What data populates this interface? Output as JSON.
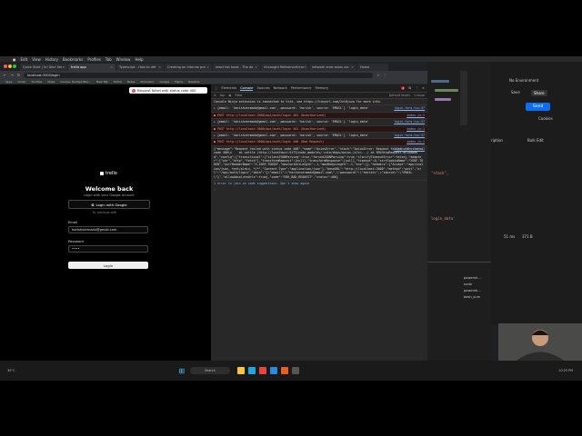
{
  "menubar": {
    "items": [
      "Edit",
      "View",
      "History",
      "Bookmarks",
      "Profiles",
      "Tab",
      "Window",
      "Help"
    ]
  },
  "browser": {
    "tabs": [
      {
        "label": "Quick Start | Sri Devi Ver"
      },
      {
        "label": "trello app",
        "active": true
      },
      {
        "label": "Typescript - How to def"
      },
      {
        "label": "Creating an internal pro"
      },
      {
        "label": "react hot toast - The do"
      },
      {
        "label": "Uncaught ReferenceError"
      },
      {
        "label": "network error axios via"
      },
      {
        "label": "Home"
      }
    ],
    "url": "localhost:3000/login",
    "bookmarks": [
      "Apps",
      "Gmail",
      "YouTube",
      "Maps",
      "Course: DevOps Boo...",
      "New Tab",
      "TikTok",
      "Notes",
      "Pomodoro",
      "Google",
      "Figma",
      "Readme"
    ]
  },
  "page": {
    "toast": "Request failed with status code 400",
    "logo": "trello",
    "title": "Welcome back",
    "subtitle": "Login with your Google account",
    "google_button": "Login with Google",
    "divider": "Or continue with",
    "email_label": "Email",
    "email_value": "harishvermadx@gmail.com",
    "password_label": "Password",
    "password_value": "••••",
    "login_button": "Login"
  },
  "devtools": {
    "tabs": [
      "Elements",
      "Console",
      "Sources",
      "Network",
      "Performance",
      "Memory"
    ],
    "active_tab": "Console",
    "error_count": "4",
    "filter_context": "top",
    "filter_placeholder": "Filter",
    "levels": "Default levels",
    "issues": "1 Issue",
    "messages": [
      {
        "type": "info",
        "text": "Console Ninja extension is connected to Vite, see https://tinyurl.com/2vt8jxzw for more info.",
        "src": "index.js:1"
      },
      {
        "type": "log",
        "text": "▸ {email: 'harishvermadx@gmail.com', password: 'harish', source: 'EMAIL'} 'login_data'",
        "src": "login-form.tsx:37"
      },
      {
        "type": "err",
        "text": "● POST http://localhost:3000/api/auth/login 401 (Unauthorized)",
        "src": "index.js:1"
      },
      {
        "type": "log",
        "text": "▸ {email: 'harishvermadx@gmail.com', password: 'harish', source: 'EMAIL'} 'login_data'",
        "src": "login-form.tsx:37"
      },
      {
        "type": "err",
        "text": "● POST http://localhost:3000/api/auth/login 401 (Unauthorized)",
        "src": "index.js:1"
      },
      {
        "type": "log",
        "text": "▸ {email: 'harishvermadx@gmail.com', password: 'harish', source: 'EMAIL'} 'login_data'",
        "src": "login-form.tsx:37"
      },
      {
        "type": "err",
        "text": "● POST http://localhost:3000/api/auth/login 400 (Bad Request)",
        "src": "index.js:1"
      },
      {
        "type": "log",
        "text": "{\"message\":\"Request failed with status code 400\",\"name\":\"AxiosError\",\"stack\":\"AxiosError: Request failed with status code 400\\n    at settle (http://localhost:5173/node_modules/.vite/deps/axios.js?v=...) at XMLHttpRequest.onloadend\",\"config\":{\"transitional\":{\"silentJSONParsing\":true,\"forcedJSONParsing\":true,\"clarifyTimeoutError\":false},\"adapter\":[\"xhr\",\"http\",\"fetch\"],\"transformRequest\":[null],\"transformResponse\":[null],\"timeout\":0,\"xsrfCookieName\":\"XSRF-TOKEN\",\"xsrfHeaderName\":\"X-XSRF-TOKEN\",\"maxContentLength\":-1,\"maxBodyLength\":-1,\"env\":{},\"headers\":{\"Accept\":\"application/json, text/plain, */*\",\"Content-Type\":\"application/json\"},\"baseURL\":\"http://localhost:3000\",\"method\":\"post\",\"url\":\"/api/auth/login\",\"data\":\"{\\\"email\\\":\\\"harishvermadx@gmail.com\\\",\\\"password\\\":\\\"harish\\\",\\\"source\\\":\\\"EMAIL\\\"}\",\"allowAbsoluteUrls\":true},\"code\":\"ERR_BAD_REQUEST\",\"status\":400}",
        "src": "login-form.tsx:41"
      }
    ],
    "footer": "1 error to join on code suggestions. Don't show again"
  },
  "editor": {
    "snippet1": "\"stack\",",
    "snippet2": "login_data'"
  },
  "postman": {
    "env": "No Environment",
    "save": "Save",
    "share": "Share",
    "send": "Send",
    "cookies": "Cookies",
    "description": "ription",
    "bulk_edit": "Bulk Edit",
    "status": "51 ms",
    "size": "371 B",
    "files": [
      "powersh...",
      "node",
      "powersh...",
      "bash_sum"
    ]
  },
  "taskbar": {
    "search": "Search",
    "weather": "30°C",
    "status_left": "Ln 41, Col 23",
    "time": "10:29 PM"
  }
}
